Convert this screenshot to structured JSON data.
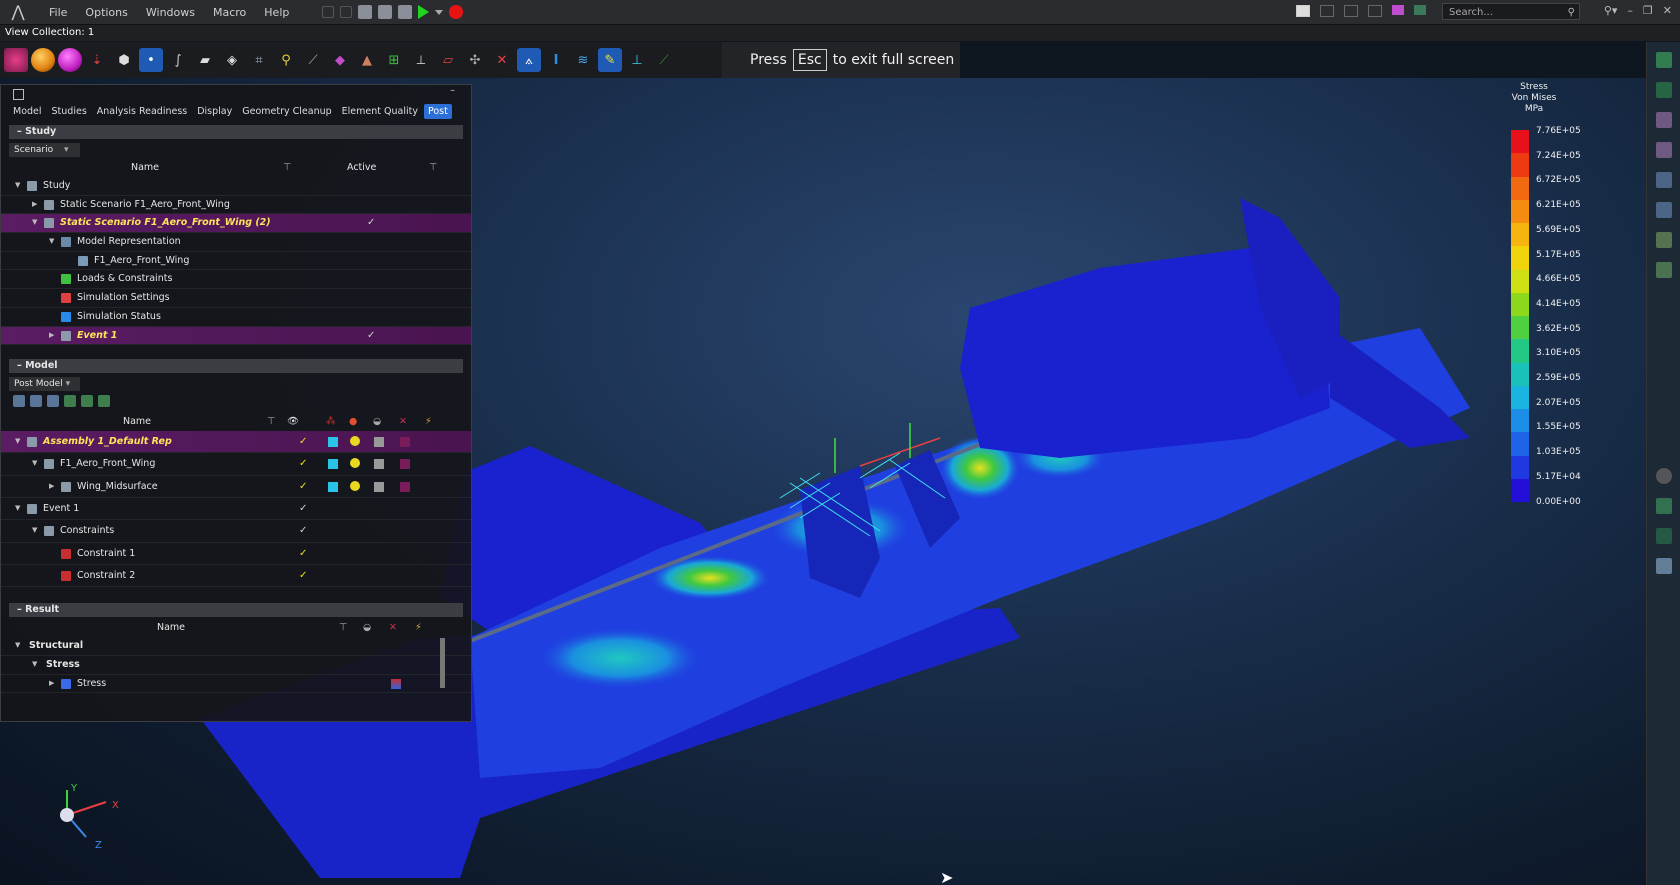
{
  "menubar": {
    "items": [
      "File",
      "Options",
      "Windows",
      "Macro",
      "Help"
    ],
    "search_placeholder": "Search..."
  },
  "view_collection": "View Collection: 1",
  "fullscreen_hint": {
    "pre": "Press",
    "key": "Esc",
    "post": "to exit full screen"
  },
  "panel": {
    "tabs": [
      {
        "label": "Model",
        "active": false
      },
      {
        "label": "Studies",
        "active": false
      },
      {
        "label": "Analysis Readiness",
        "active": false
      },
      {
        "label": "Display",
        "active": false
      },
      {
        "label": "Geometry Cleanup",
        "active": false
      },
      {
        "label": "Element Quality",
        "active": false
      },
      {
        "label": "Post",
        "active": true
      }
    ],
    "study": {
      "section_label": "Study",
      "dropdown": "Scenario",
      "col_name": "Name",
      "col_active": "Active",
      "rows": [
        {
          "label": "Study",
          "level": 0,
          "expander": "open",
          "icon": "study-icon",
          "active": "",
          "hl": false
        },
        {
          "label": "Static Scenario F1_Aero_Front_Wing",
          "level": 1,
          "expander": "closed",
          "icon": "scenario-icon",
          "active": "",
          "hl": false
        },
        {
          "label": "Static Scenario F1_Aero_Front_Wing (2)",
          "level": 1,
          "expander": "open",
          "icon": "scenario-icon",
          "active": "✓",
          "hl": true
        },
        {
          "label": "Model Representation",
          "level": 2,
          "expander": "open",
          "icon": "representation-icon",
          "active": "",
          "hl": false
        },
        {
          "label": "F1_Aero_Front_Wing",
          "level": 3,
          "expander": "",
          "icon": "part-icon",
          "active": "",
          "hl": false
        },
        {
          "label": "Loads & Constraints",
          "level": 2,
          "expander": "",
          "icon": "loads-icon",
          "active": "",
          "hl": false
        },
        {
          "label": "Simulation Settings",
          "level": 2,
          "expander": "",
          "icon": "settings-icon",
          "active": "",
          "hl": false
        },
        {
          "label": "Simulation Status",
          "level": 2,
          "expander": "",
          "icon": "status-icon",
          "active": "",
          "hl": false
        },
        {
          "label": "Event 1",
          "level": 2,
          "expander": "closed",
          "icon": "event-icon",
          "active": "✓",
          "hl": true
        }
      ]
    },
    "model": {
      "section_label": "Model",
      "dropdown": "Post Model",
      "col_name": "Name",
      "rows": [
        {
          "label": "Assembly 1_Default Rep",
          "level": 0,
          "expander": "open",
          "check": "✓",
          "color": "#29c4e8",
          "hl": true
        },
        {
          "label": "F1_Aero_Front_Wing",
          "level": 1,
          "expander": "open",
          "check": "✓",
          "color": "#29c4e8",
          "hl": false
        },
        {
          "label": "Wing_Midsurface",
          "level": 2,
          "expander": "closed",
          "check": "✓",
          "color": "#29c4e8",
          "hl": false
        },
        {
          "label": "Event 1",
          "level": 0,
          "expander": "open",
          "check": "✓",
          "color": "",
          "hl": false
        },
        {
          "label": "Constraints",
          "level": 1,
          "expander": "open",
          "check": "✓",
          "color": "",
          "hl": false
        },
        {
          "label": "Constraint 1",
          "level": 2,
          "expander": "",
          "check": "✓",
          "color": "",
          "hl": false
        },
        {
          "label": "Constraint 2",
          "level": 2,
          "expander": "",
          "check": "✓",
          "color": "",
          "hl": false
        }
      ]
    },
    "result": {
      "section_label": "Result",
      "col_name": "Name",
      "rows": [
        {
          "label": "Structural",
          "level": 0,
          "expander": "open"
        },
        {
          "label": "Stress",
          "level": 1,
          "expander": "open"
        },
        {
          "label": "Stress",
          "level": 2,
          "expander": "closed"
        }
      ]
    }
  },
  "legend": {
    "title_lines": [
      "Stress",
      "Von Mises",
      "MPa"
    ],
    "values": [
      "7.76E+05",
      "7.24E+05",
      "6.72E+05",
      "6.21E+05",
      "5.69E+05",
      "5.17E+05",
      "4.66E+05",
      "4.14E+05",
      "3.62E+05",
      "3.10E+05",
      "2.59E+05",
      "2.07E+05",
      "1.55E+05",
      "1.03E+05",
      "5.17E+04",
      "0.00E+00"
    ],
    "colors": [
      "#e8101a",
      "#ee3a12",
      "#f06810",
      "#f48c10",
      "#f6b40e",
      "#f0d40c",
      "#cde014",
      "#8ed81c",
      "#4ed040",
      "#22c884",
      "#18c2b8",
      "#1ab4e0",
      "#1c8ee8",
      "#1e64e8",
      "#2038e0",
      "#2210d8"
    ]
  },
  "triad": {
    "x": "X",
    "y": "Y",
    "z": "Z"
  }
}
